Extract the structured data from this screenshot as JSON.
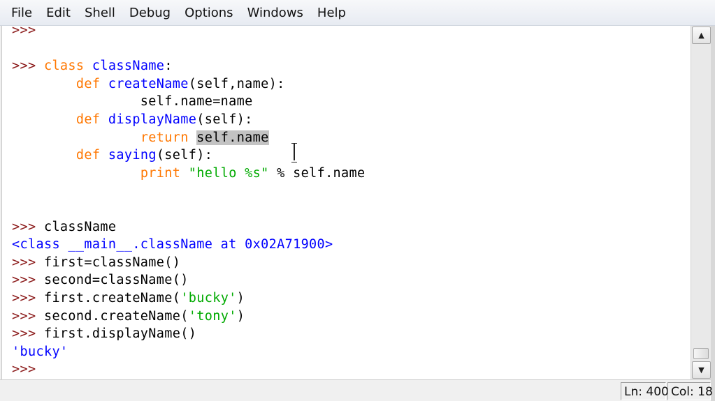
{
  "menubar": {
    "items": [
      "File",
      "Edit",
      "Shell",
      "Debug",
      "Options",
      "Windows",
      "Help"
    ]
  },
  "editor": {
    "lines": [
      [
        {
          "t": ">>>",
          "c": "prompt"
        }
      ],
      [],
      [
        {
          "t": ">>> ",
          "c": "prompt"
        },
        {
          "t": "class",
          "c": "kw"
        },
        {
          "t": " "
        },
        {
          "t": "className",
          "c": "def"
        },
        {
          "t": ":"
        }
      ],
      [
        {
          "t": "        "
        },
        {
          "t": "def",
          "c": "kw"
        },
        {
          "t": " "
        },
        {
          "t": "createName",
          "c": "def"
        },
        {
          "t": "(self,name):"
        }
      ],
      [
        {
          "t": "                self.name=name"
        }
      ],
      [
        {
          "t": "        "
        },
        {
          "t": "def",
          "c": "kw"
        },
        {
          "t": " "
        },
        {
          "t": "displayName",
          "c": "def"
        },
        {
          "t": "(self):"
        }
      ],
      [
        {
          "t": "                "
        },
        {
          "t": "return",
          "c": "kw"
        },
        {
          "t": " "
        },
        {
          "t": "self.name",
          "c": "sel"
        }
      ],
      [
        {
          "t": "        "
        },
        {
          "t": "def",
          "c": "kw"
        },
        {
          "t": " "
        },
        {
          "t": "saying",
          "c": "def"
        },
        {
          "t": "(self):"
        }
      ],
      [
        {
          "t": "                "
        },
        {
          "t": "print",
          "c": "kw"
        },
        {
          "t": " "
        },
        {
          "t": "\"hello %s\"",
          "c": "str"
        },
        {
          "t": " % self.name"
        }
      ],
      [],
      [],
      [
        {
          "t": ">>> ",
          "c": "prompt"
        },
        {
          "t": "className"
        }
      ],
      [
        {
          "t": "<class __main__.className at 0x02A71900>",
          "c": "out"
        }
      ],
      [
        {
          "t": ">>> ",
          "c": "prompt"
        },
        {
          "t": "first=className()"
        }
      ],
      [
        {
          "t": ">>> ",
          "c": "prompt"
        },
        {
          "t": "second=className()"
        }
      ],
      [
        {
          "t": ">>> ",
          "c": "prompt"
        },
        {
          "t": "first.createName("
        },
        {
          "t": "'bucky'",
          "c": "str"
        },
        {
          "t": ")"
        }
      ],
      [
        {
          "t": ">>> ",
          "c": "prompt"
        },
        {
          "t": "second.createName("
        },
        {
          "t": "'tony'",
          "c": "str"
        },
        {
          "t": ")"
        }
      ],
      [
        {
          "t": ">>> ",
          "c": "prompt"
        },
        {
          "t": "first.displayName()"
        }
      ],
      [
        {
          "t": "'bucky'",
          "c": "out"
        }
      ],
      [
        {
          "t": ">>>",
          "c": "prompt"
        }
      ]
    ]
  },
  "scrollbar": {
    "up_icon": "▲",
    "down_icon": "▼"
  },
  "status": {
    "line": "Ln: 400",
    "col": "Col: 18"
  },
  "colors": {
    "prompt": "#8b1a1a",
    "keyword": "#ff7700",
    "definition": "#0000ff",
    "string": "#00aa00",
    "output": "#0000ff",
    "selection": "#c3c3c3"
  }
}
